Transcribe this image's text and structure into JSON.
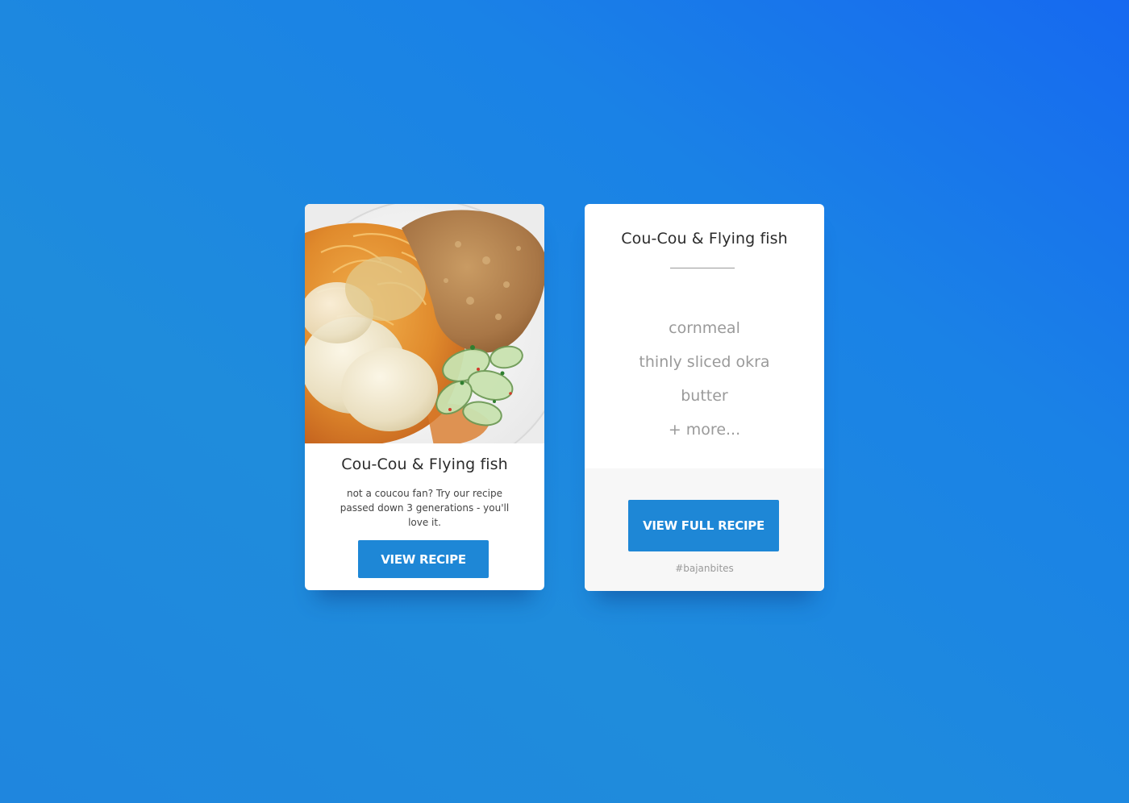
{
  "colors": {
    "background_start": "#1669f0",
    "background_end": "#1f86de",
    "button": "#1e87d6",
    "card": "#ffffff",
    "card_footer": "#f7f7f7",
    "muted_text": "#9a9a9a"
  },
  "preview_card": {
    "image_icon": "food-plate-photo",
    "title": "Cou-Cou & Flying fish",
    "description": "not a coucou fan? Try our recipe passed down 3 generations - you'll love it.",
    "button_label": "VIEW RECIPE"
  },
  "ingredients_card": {
    "title": "Cou-Cou & Flying fish",
    "ingredients": [
      "cornmeal",
      "thinly sliced okra",
      "butter",
      "+ more..."
    ],
    "button_label": "VIEW FULL RECIPE",
    "hashtag": "#bajanbites"
  }
}
